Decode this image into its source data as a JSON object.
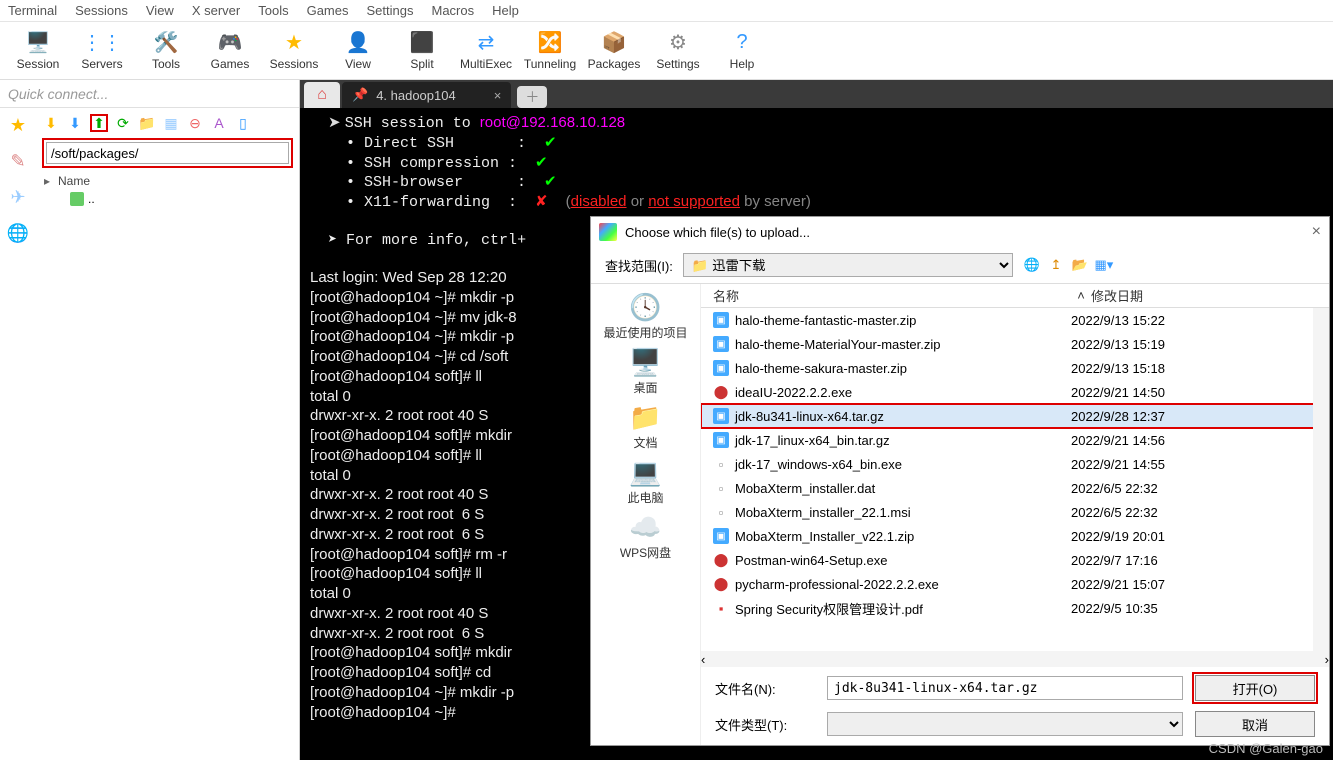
{
  "menubar": [
    "Terminal",
    "Sessions",
    "View",
    "X server",
    "Tools",
    "Games",
    "Settings",
    "Macros",
    "Help"
  ],
  "toolbar": [
    {
      "label": "Session",
      "icon": "🖥️",
      "color": "#4a4"
    },
    {
      "label": "Servers",
      "icon": "⋮⋮",
      "color": "#39f"
    },
    {
      "label": "Tools",
      "icon": "🛠️",
      "color": "#d33"
    },
    {
      "label": "Games",
      "icon": "🎮",
      "color": "#555"
    },
    {
      "label": "Sessions",
      "icon": "★",
      "color": "#fb0"
    },
    {
      "label": "View",
      "icon": "👤",
      "color": "#a6c"
    },
    {
      "label": "Split",
      "icon": "⬛",
      "color": "#d44"
    },
    {
      "label": "MultiExec",
      "icon": "⇄",
      "color": "#39f"
    },
    {
      "label": "Tunneling",
      "icon": "🔀",
      "color": "#3a5"
    },
    {
      "label": "Packages",
      "icon": "📦",
      "color": "#c90"
    },
    {
      "label": "Settings",
      "icon": "⚙",
      "color": "#888"
    },
    {
      "label": "Help",
      "icon": "?",
      "color": "#39f"
    }
  ],
  "sidebar": {
    "quick_connect": "Quick connect...",
    "path": "/soft/packages/",
    "tree_header": "Name",
    "tree_item": ".."
  },
  "tabs": {
    "home": "⌂",
    "ssh_label": "4. hadoop104"
  },
  "terminal": {
    "banner": {
      "ssh_to": "SSH session to ",
      "user": "root@192.168.10.128",
      "l1": "Direct SSH",
      "l2": "SSH compression",
      "l3": "SSH-browser",
      "l4": "X11-forwarding",
      "x11_off": "(disabled or not supported by server)",
      "more": "For more info, ctrl+"
    },
    "lines": [
      "Last login: Wed Sep 28 12:20",
      "[root@hadoop104 ~]# mkdir -p",
      "[root@hadoop104 ~]# mv jdk-8",
      "[root@hadoop104 ~]# mkdir -p",
      "[root@hadoop104 ~]# cd /soft",
      "[root@hadoop104 soft]# ll",
      "total 0",
      "drwxr-xr-x. 2 root root 40 S",
      "[root@hadoop104 soft]# mkdir",
      "[root@hadoop104 soft]# ll",
      "total 0",
      "drwxr-xr-x. 2 root root 40 S",
      "drwxr-xr-x. 2 root root  6 S",
      "drwxr-xr-x. 2 root root  6 S",
      "[root@hadoop104 soft]# rm -r",
      "[root@hadoop104 soft]# ll",
      "total 0",
      "drwxr-xr-x. 2 root root 40 S",
      "drwxr-xr-x. 2 root root  6 S",
      "[root@hadoop104 soft]# mkdir",
      "[root@hadoop104 soft]# cd",
      "[root@hadoop104 ~]# mkdir -p",
      "[root@hadoop104 ~]#"
    ]
  },
  "dialog": {
    "title": "Choose which file(s) to upload...",
    "lookin_label": "查找范围(I):",
    "lookin_value": "迅雷下载",
    "places": [
      {
        "label": "最近使用的项目",
        "icon": "🕓"
      },
      {
        "label": "桌面",
        "icon": "🖥️"
      },
      {
        "label": "文档",
        "icon": "📁"
      },
      {
        "label": "此电脑",
        "icon": "💻"
      },
      {
        "label": "WPS网盘",
        "icon": "☁️"
      }
    ],
    "col_name": "名称",
    "col_date": "修改日期",
    "files": [
      {
        "name": "halo-theme-fantastic-master.zip",
        "date": "2022/9/13 15:22",
        "t": "zip"
      },
      {
        "name": "halo-theme-MaterialYour-master.zip",
        "date": "2022/9/13 15:19",
        "t": "zip"
      },
      {
        "name": "halo-theme-sakura-master.zip",
        "date": "2022/9/13 15:18",
        "t": "zip"
      },
      {
        "name": "ideaIU-2022.2.2.exe",
        "date": "2022/9/21 14:50",
        "t": "exe"
      },
      {
        "name": "jdk-8u341-linux-x64.tar.gz",
        "date": "2022/9/28 12:37",
        "t": "zip",
        "sel": true,
        "hl": true
      },
      {
        "name": "jdk-17_linux-x64_bin.tar.gz",
        "date": "2022/9/21 14:56",
        "t": "zip"
      },
      {
        "name": "jdk-17_windows-x64_bin.exe",
        "date": "2022/9/21 14:55",
        "t": "file"
      },
      {
        "name": "MobaXterm_installer.dat",
        "date": "2022/6/5 22:32",
        "t": "file"
      },
      {
        "name": "MobaXterm_installer_22.1.msi",
        "date": "2022/6/5 22:32",
        "t": "msi"
      },
      {
        "name": "MobaXterm_Installer_v22.1.zip",
        "date": "2022/9/19 20:01",
        "t": "zip"
      },
      {
        "name": "Postman-win64-Setup.exe",
        "date": "2022/9/7 17:16",
        "t": "exe"
      },
      {
        "name": "pycharm-professional-2022.2.2.exe",
        "date": "2022/9/21 15:07",
        "t": "exe"
      },
      {
        "name": "Spring Security权限管理设计.pdf",
        "date": "2022/9/5 10:35",
        "t": "pdf"
      }
    ],
    "filename_label": "文件名(N):",
    "filename_value": "jdk-8u341-linux-x64.tar.gz",
    "filetype_label": "文件类型(T):",
    "open_btn": "打开(O)",
    "cancel_btn": "取消"
  },
  "watermark": "CSDN @Galen-gao"
}
